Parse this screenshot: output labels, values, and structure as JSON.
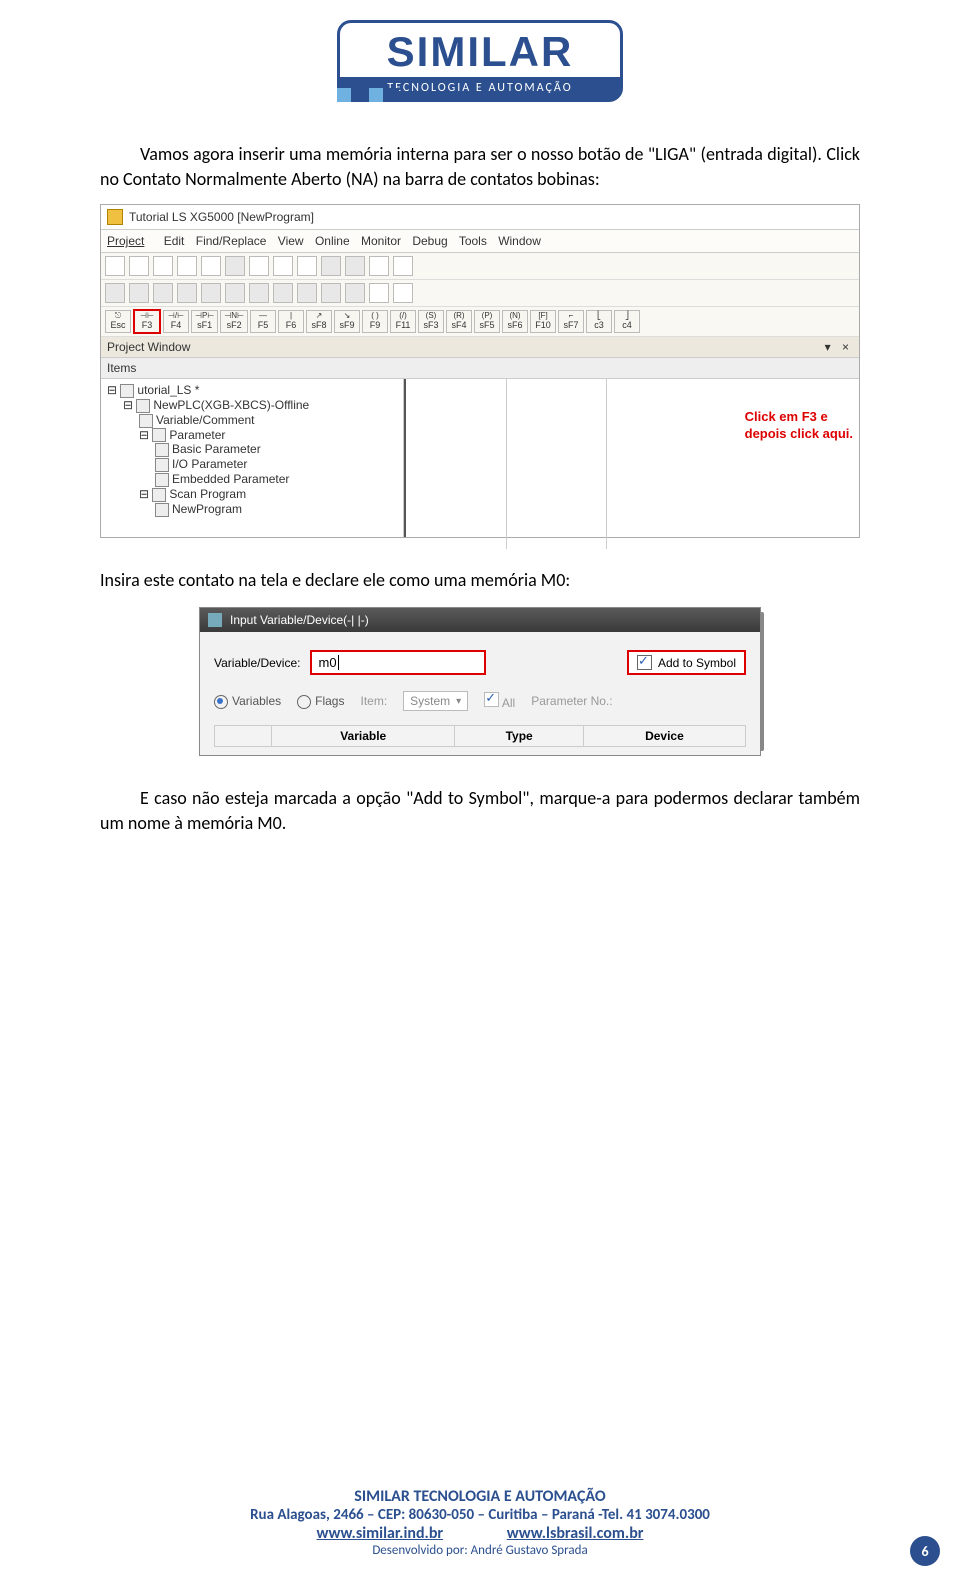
{
  "logo": {
    "brand": "SIMILAR",
    "tagline": "TECNOLOGIA E AUTOMAÇÃO"
  },
  "para1a": "Vamos agora inserir uma memória interna para ser o nosso botão de \"LIGA\" (entrada digital).  Click no Contato Normalmente Aberto (NA) na barra de contatos bobinas:",
  "para2": "Insira este contato na tela e declare ele como uma memória M0:",
  "para3": "E caso não esteja marcada a opção \"Add to Symbol\", marque-a para podermos declarar também um nome à memória M0.",
  "shot1": {
    "title": "Tutorial LS   XG5000   [NewProgram]",
    "menu": [
      "Project",
      "Edit",
      "Find/Replace",
      "View",
      "Online",
      "Monitor",
      "Debug",
      "Tools",
      "Window"
    ],
    "fn": [
      "Esc",
      "F3",
      "F4",
      "sF1",
      "sF2",
      "F5",
      "F6",
      "sF8",
      "sF9",
      "F9",
      "F11",
      "sF3",
      "sF4",
      "sF5",
      "sF6",
      "F10",
      "sF7",
      "c3",
      "c4"
    ],
    "proj_window": "Project Window",
    "close_x": "×",
    "items_hdr": "Items",
    "tree": {
      "root": "utorial_LS *",
      "plc": "NewPLC(XGB-XBCS)-Offline",
      "nodes": [
        "Variable/Comment",
        "Parameter",
        "Basic Parameter",
        "I/O Parameter",
        "Embedded Parameter",
        "Scan Program",
        "NewProgram"
      ]
    },
    "hint": "Click em F3 e\ndepois click aqui."
  },
  "shot2": {
    "title": "Input Variable/Device(-| |-)",
    "vd_label": "Variable/Device:",
    "vd_value": "m0",
    "add_label": "Add to Symbol",
    "opt_var": "Variables",
    "opt_flags": "Flags",
    "item_lbl": "Item:",
    "item_val": "System",
    "all_lbl": "All",
    "param_lbl": "Parameter No.:",
    "cols": [
      "",
      "Variable",
      "Type",
      "Device"
    ]
  },
  "footer": {
    "l1": "SIMILAR TECNOLOGIA E AUTOMAÇÃO",
    "l2": "Rua Alagoas, 2466 – CEP: 80630-050 – Curitiba – Paraná -Tel. 41 3074.0300",
    "link1": "www.similar.ind.br",
    "link2": "www.lsbrasil.com.br",
    "l4": "Desenvolvido por: André Gustavo Sprada",
    "page": "6"
  }
}
